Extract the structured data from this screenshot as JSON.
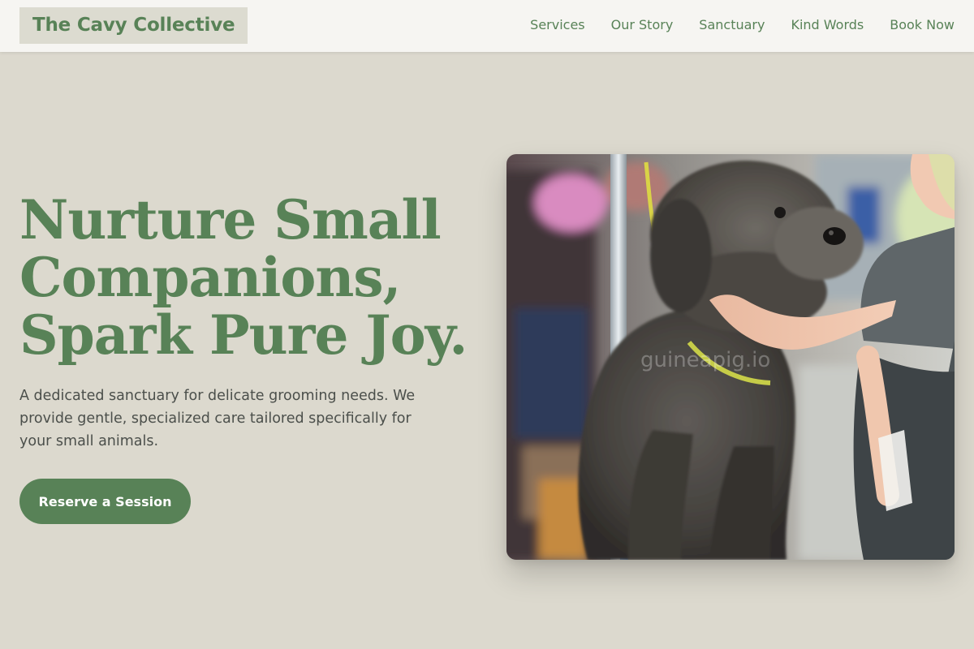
{
  "header": {
    "logo": "The Cavy Collective",
    "nav": [
      {
        "label": "Services"
      },
      {
        "label": "Our Story"
      },
      {
        "label": "Sanctuary"
      },
      {
        "label": "Kind Words"
      },
      {
        "label": "Book Now"
      }
    ]
  },
  "hero": {
    "title_lines": [
      "Nurture Small",
      "Companions,",
      "Spark Pure Joy."
    ],
    "subtitle": "A dedicated sanctuary for delicate grooming needs. We provide gentle, specialized care tailored specifically for your small animals.",
    "cta_label": "Reserve a Session",
    "image": {
      "subject": "groomer-with-poodle-photo",
      "watermark": "guineapig.io"
    }
  },
  "colors": {
    "page_background": "#dcd9ce",
    "header_background": "#f6f5f2",
    "logo_background": "#dcdbd0",
    "accent_green": "#588257",
    "body_text": "#4b4f4b",
    "button_text": "#ffffff"
  }
}
